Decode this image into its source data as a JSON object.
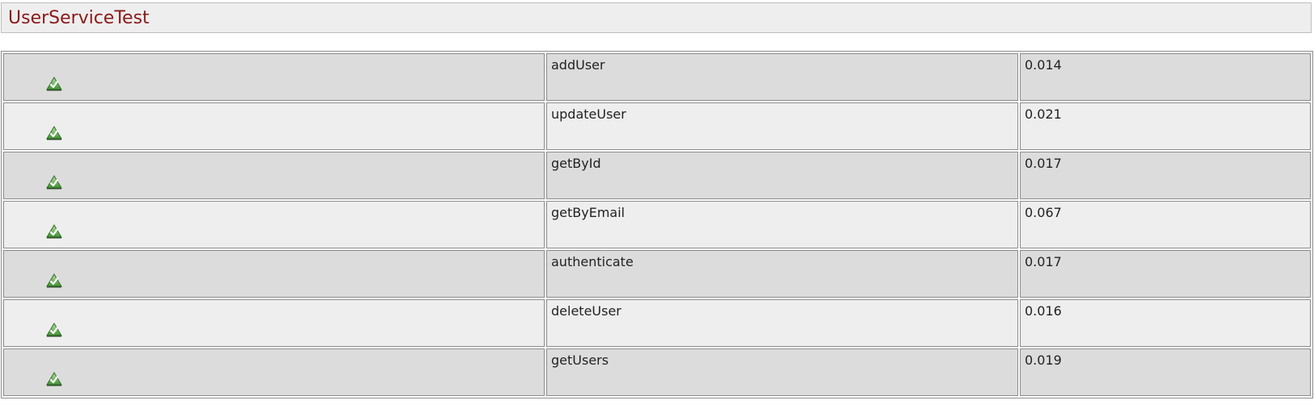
{
  "page": {
    "title": "UserServiceTest"
  },
  "colors": {
    "title": "#8b1a1a",
    "row_odd": "#dcdcdc",
    "row_even": "#eeeeee",
    "pass_icon": "#5aa845"
  },
  "tests": [
    {
      "status_icon": "pass-check-icon",
      "name": "addUser",
      "time": "0.014"
    },
    {
      "status_icon": "pass-check-icon",
      "name": "updateUser",
      "time": "0.021"
    },
    {
      "status_icon": "pass-check-icon",
      "name": "getById",
      "time": "0.017"
    },
    {
      "status_icon": "pass-check-icon",
      "name": "getByEmail",
      "time": "0.067"
    },
    {
      "status_icon": "pass-check-icon",
      "name": "authenticate",
      "time": "0.017"
    },
    {
      "status_icon": "pass-check-icon",
      "name": "deleteUser",
      "time": "0.016"
    },
    {
      "status_icon": "pass-check-icon",
      "name": "getUsers",
      "time": "0.019"
    }
  ]
}
